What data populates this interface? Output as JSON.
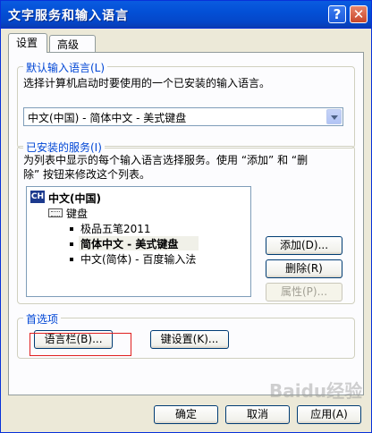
{
  "window": {
    "title": "文字服务和输入语言",
    "help_label": "?",
    "close_label": "✕"
  },
  "tabs": [
    {
      "label": "设置",
      "active": true
    },
    {
      "label": "高级",
      "active": false
    }
  ],
  "default_language": {
    "legend": "默认输入语言(L)",
    "description": "选择计算机启动时要使用的一个已安装的输入语言。",
    "selected_value": "中文(中国) - 简体中文 - 美式键盘"
  },
  "installed_services": {
    "legend": "已安装的服务(I)",
    "description_line1": "为列表中显示的每个输入语言选择服务。使用 “添加” 和 “删",
    "description_line2": "除” 按钮来修改这个列表。",
    "tree": {
      "language_icon": "CH",
      "language": "中文(中国)",
      "keyboard_label": "键盘",
      "items": [
        {
          "label": "极品五笔2011",
          "bold": false
        },
        {
          "label": "简体中文 - 美式键盘",
          "bold": true
        },
        {
          "label": "中文(简体) - 百度输入法",
          "bold": false
        }
      ]
    },
    "buttons": {
      "add": "添加(D)...",
      "remove": "删除(R)",
      "properties": "属性(P)..."
    }
  },
  "preferences": {
    "legend": "首选项",
    "language_bar_button": "语言栏(B)...",
    "key_settings_button": "键设置(K)..."
  },
  "footer": {
    "ok": "确定",
    "cancel": "取消",
    "apply": "应用(A)"
  },
  "watermark": "Baidu经验",
  "colors": {
    "titlebar": "#0a5be0",
    "legend_text": "#0046d5",
    "highlight": "#e02020"
  }
}
